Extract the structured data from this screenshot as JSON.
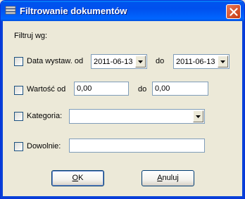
{
  "window": {
    "title": "Filtrowanie dokumentów"
  },
  "filter_label": "Filtruj wg:",
  "date_filter": {
    "label": "Data wystaw. od",
    "from_value": "2011-06-13",
    "to_label": "do",
    "to_value": "2011-06-13",
    "checked": false
  },
  "value_filter": {
    "label": "Wartość od",
    "from_value": "0,00",
    "to_label": "do",
    "to_value": "0,00",
    "checked": false
  },
  "category_filter": {
    "label": "Kategoria:",
    "value": "",
    "checked": false
  },
  "any_filter": {
    "label": "Dowolnie:",
    "value": "",
    "checked": false
  },
  "buttons": {
    "ok_accel": "O",
    "ok_rest": "K",
    "cancel_accel": "A",
    "cancel_rest": "nuluj"
  },
  "colors": {
    "title_bar": "#0053ee",
    "close_button": "#e35a2e",
    "dialog_bg": "#ece9d8"
  }
}
